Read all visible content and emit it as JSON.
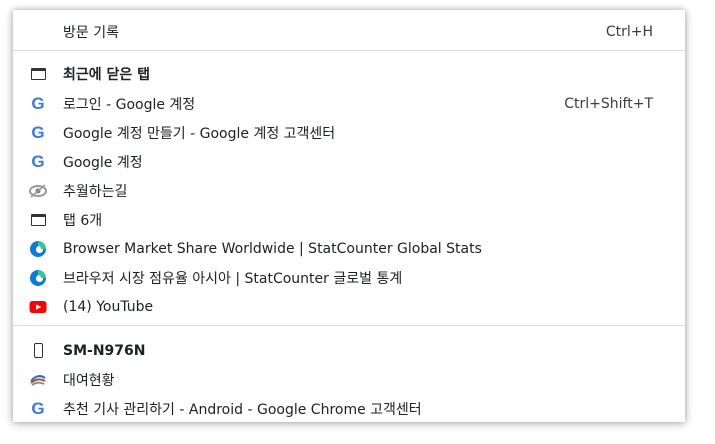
{
  "menu": {
    "history": {
      "label": "방문 기록",
      "shortcut": "Ctrl+H"
    },
    "recent": {
      "header": "최근에 닫은 탭",
      "items": [
        {
          "label": "로그인 - Google 계정",
          "shortcut": "Ctrl+Shift+T",
          "icon": "google-icon"
        },
        {
          "label": "Google 계정 만들기 - Google 계정 고객센터",
          "icon": "google-icon"
        },
        {
          "label": "Google 계정",
          "icon": "google-icon"
        },
        {
          "label": "추월하는길",
          "icon": "site-favicon"
        },
        {
          "label": "탭 6개",
          "icon": "tab-group-icon"
        },
        {
          "label": "Browser Market Share Worldwide | StatCounter Global Stats",
          "icon": "edge-icon"
        },
        {
          "label": "브라우저 시장 점유율 아시아 | StatCounter 글로벌 통계",
          "icon": "edge-icon"
        },
        {
          "label": "(14) YouTube",
          "icon": "youtube-icon"
        }
      ]
    },
    "device": {
      "name": "SM-N976N",
      "items": [
        {
          "label": "대여현황",
          "icon": "site-favicon"
        },
        {
          "label": "추천 기사 관리하기 - Android - Google Chrome 고객센터",
          "icon": "google-icon"
        }
      ]
    }
  },
  "colors": {
    "google_blue": "#3b78e7",
    "edge_blue": "#0c7bd8",
    "youtube_red": "#ff0000",
    "separator": "#dcdcdc"
  }
}
